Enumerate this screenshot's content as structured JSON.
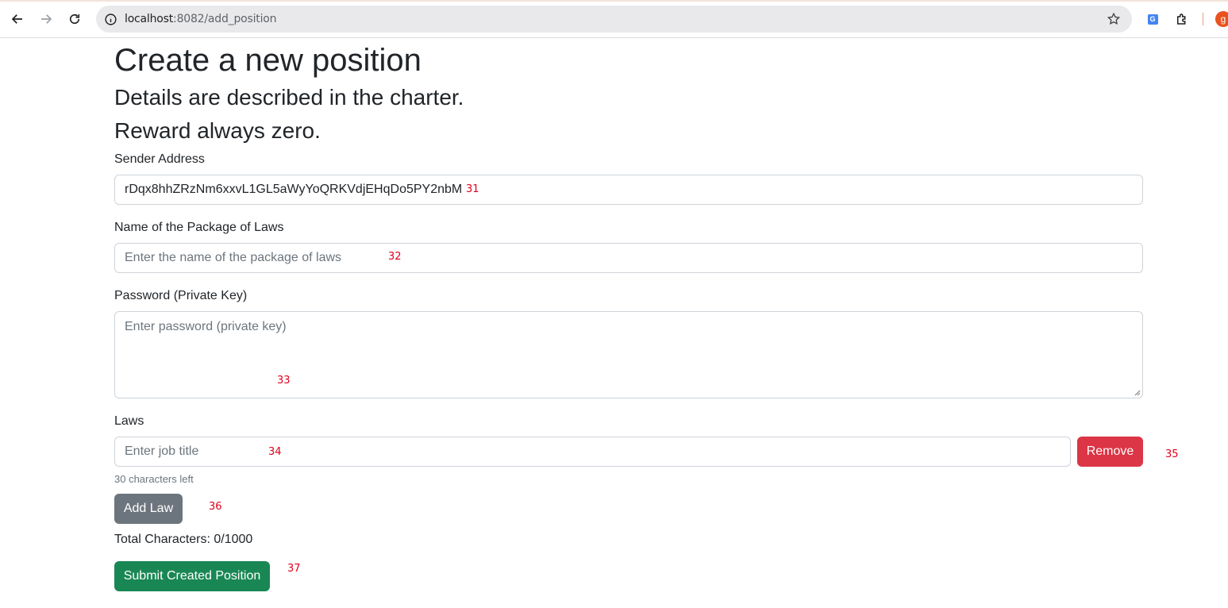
{
  "browser": {
    "url_host": "localhost",
    "url_path": ":8082/add_position",
    "profile_initial": "g"
  },
  "page": {
    "title": "Create a new position",
    "subtitle1": "Details are described in the charter.",
    "subtitle2": "Reward always zero."
  },
  "form": {
    "sender_label": "Sender Address",
    "sender_value": "rDqx8hhZRzNm6xxvL1GL5aWyYoQRKVdjEHqDo5PY2nbM",
    "package_label": "Name of the Package of Laws",
    "package_placeholder": "Enter the name of the package of laws",
    "password_label": "Password (Private Key)",
    "password_placeholder": "Enter password (private key)",
    "laws_label": "Laws",
    "law_placeholder": "Enter job title",
    "remove_label": "Remove",
    "chars_left": "30 characters left",
    "add_law_label": "Add Law",
    "total_characters": "Total Characters: 0/1000",
    "submit_label": "Submit Created Position"
  },
  "markers": {
    "m31": "31",
    "m32": "32",
    "m33": "33",
    "m34": "34",
    "m35": "35",
    "m36": "36",
    "m37": "37"
  }
}
